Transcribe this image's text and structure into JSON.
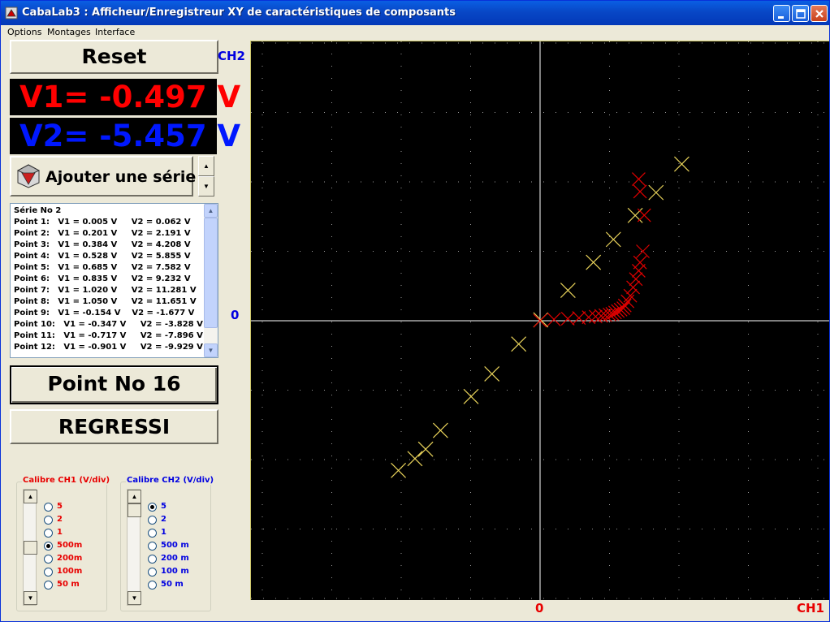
{
  "window": {
    "title": "CabaLab3 : Afficheur/Enregistreur XY de caractéristiques de composants"
  },
  "menu": [
    "Options",
    "Montages",
    "Interface"
  ],
  "controls": {
    "reset_label": "Reset",
    "v1_text": "V1= -0.497 V",
    "v2_text": "V2= -5.457 V",
    "add_series_label": "Ajouter une série",
    "point_label": "Point No 16",
    "regress_label": "REGRESSI"
  },
  "series_list": {
    "lines": [
      "Série No 2",
      "Point 1:   V1 = 0.005 V     V2 = 0.062 V",
      "Point 2:   V1 = 0.201 V     V2 = 2.191 V",
      "Point 3:   V1 = 0.384 V     V2 = 4.208 V",
      "Point 4:   V1 = 0.528 V     V2 = 5.855 V",
      "Point 5:   V1 = 0.685 V     V2 = 7.582 V",
      "Point 6:   V1 = 0.835 V     V2 = 9.232 V",
      "Point 7:   V1 = 1.020 V     V2 = 11.281 V",
      "Point 8:   V1 = 1.050 V     V2 = 11.651 V",
      "Point 9:   V1 = -0.154 V    V2 = -1.677 V",
      "Point 10:   V1 = -0.347 V     V2 = -3.828 V",
      "Point 11:   V1 = -0.717 V     V2 = -7.896 V",
      "Point 12:   V1 = -0.901 V     V2 = -9.929 V"
    ]
  },
  "calibre_ch1": {
    "title": "Calibre CH1 (V/div)",
    "options": [
      "5",
      "2",
      "1",
      "500m",
      "200m",
      "100m",
      "50  m"
    ],
    "selected_index": 3,
    "color": "#e80000"
  },
  "calibre_ch2": {
    "title": "Calibre CH2 (V/div)",
    "options": [
      "5",
      "2",
      "1",
      "500 m",
      "200 m",
      "100 m",
      "50   m"
    ],
    "selected_index": 0,
    "color": "#0000e0"
  },
  "plot_labels": {
    "ch2": "CH2",
    "y_zero": "0",
    "x_zero": "0",
    "ch1": "CH1"
  },
  "chart_data": {
    "type": "scatter",
    "xlabel": "CH1",
    "ylabel": "CH2",
    "x_unit_per_div": 0.5,
    "y_unit_per_div": 5,
    "divisions_x": [
      -4,
      4
    ],
    "divisions_y": [
      -4,
      4
    ],
    "xlim": [
      -2,
      2
    ],
    "ylim": [
      -20,
      20
    ],
    "grid": true,
    "series": [
      {
        "color": "#e8d25a",
        "x": [
          0.005,
          0.201,
          0.384,
          0.528,
          0.685,
          0.835,
          1.02,
          -0.154,
          -0.347,
          -0.497,
          -0.717,
          -0.901,
          -0.824,
          -1.02
        ],
        "y": [
          0.062,
          2.191,
          4.208,
          5.855,
          7.582,
          9.232,
          11.281,
          -1.677,
          -3.828,
          -5.457,
          -7.896,
          -9.929,
          -9.25,
          -10.78
        ]
      },
      {
        "color": "#e00000",
        "x": [
          0.0,
          0.1,
          0.2,
          0.28,
          0.35,
          0.4,
          0.44,
          0.47,
          0.5,
          0.52,
          0.54,
          0.56,
          0.58,
          0.6,
          0.61,
          0.63,
          0.65,
          0.67,
          0.69,
          0.71,
          0.72,
          0.74,
          0.75,
          0.72,
          0.71
        ],
        "y": [
          0.0,
          0.1,
          0.15,
          0.2,
          0.25,
          0.3,
          0.35,
          0.4,
          0.45,
          0.5,
          0.6,
          0.7,
          0.8,
          0.9,
          1.1,
          1.4,
          1.8,
          2.4,
          3.0,
          3.6,
          4.2,
          5.0,
          7.6,
          9.3,
          10.2
        ]
      }
    ]
  }
}
